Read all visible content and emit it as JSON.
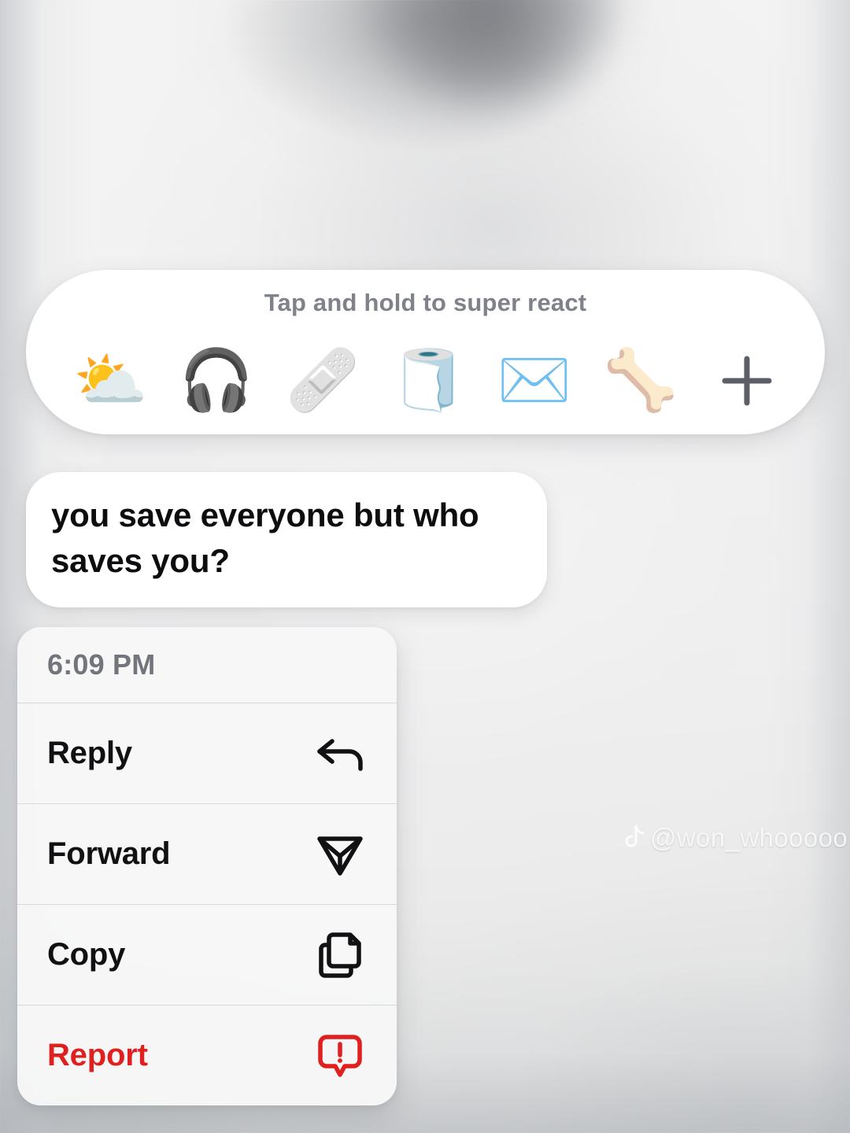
{
  "background": {
    "description": "blurred light gray photo backdrop"
  },
  "reaction_bar": {
    "hint": "Tap and hold to super react",
    "emojis": [
      {
        "name": "sun-behind-cloud-emoji",
        "glyph": "⛅",
        "label": "sun behind cloud"
      },
      {
        "name": "headphone-emoji",
        "glyph": "🎧",
        "label": "headphone"
      },
      {
        "name": "adhesive-bandage-emoji",
        "glyph": "🩹",
        "label": "adhesive bandage"
      },
      {
        "name": "roll-of-paper-emoji",
        "glyph": "🧻",
        "label": "roll of paper"
      },
      {
        "name": "envelope-emoji",
        "glyph": "✉️",
        "label": "envelope"
      },
      {
        "name": "bone-emoji",
        "glyph": "🦴",
        "label": "bone"
      }
    ],
    "add_button_label": "+"
  },
  "message": {
    "text": "you save everyone but who saves you?"
  },
  "context_menu": {
    "timestamp": "6:09 PM",
    "items": [
      {
        "label": "Reply",
        "icon": "reply-arrow-icon",
        "destructive": false
      },
      {
        "label": "Forward",
        "icon": "paper-plane-icon",
        "destructive": false
      },
      {
        "label": "Copy",
        "icon": "copy-documents-icon",
        "destructive": false
      },
      {
        "label": "Report",
        "icon": "exclamation-bubble-icon",
        "destructive": true
      }
    ]
  },
  "watermark": {
    "handle": "@won_whooooo",
    "platform_icon": "tiktok-note-icon"
  },
  "colors": {
    "destructive": "#e01f1f",
    "hint_text": "#7f8288",
    "timestamp_text": "#72757b",
    "menu_label": "#111114",
    "bubble_text": "#0d0d0f",
    "surface": "#ffffff",
    "menu_surface": "#f7f7f7",
    "divider": "#d7d8da",
    "plus_icon": "#5c5f68"
  }
}
